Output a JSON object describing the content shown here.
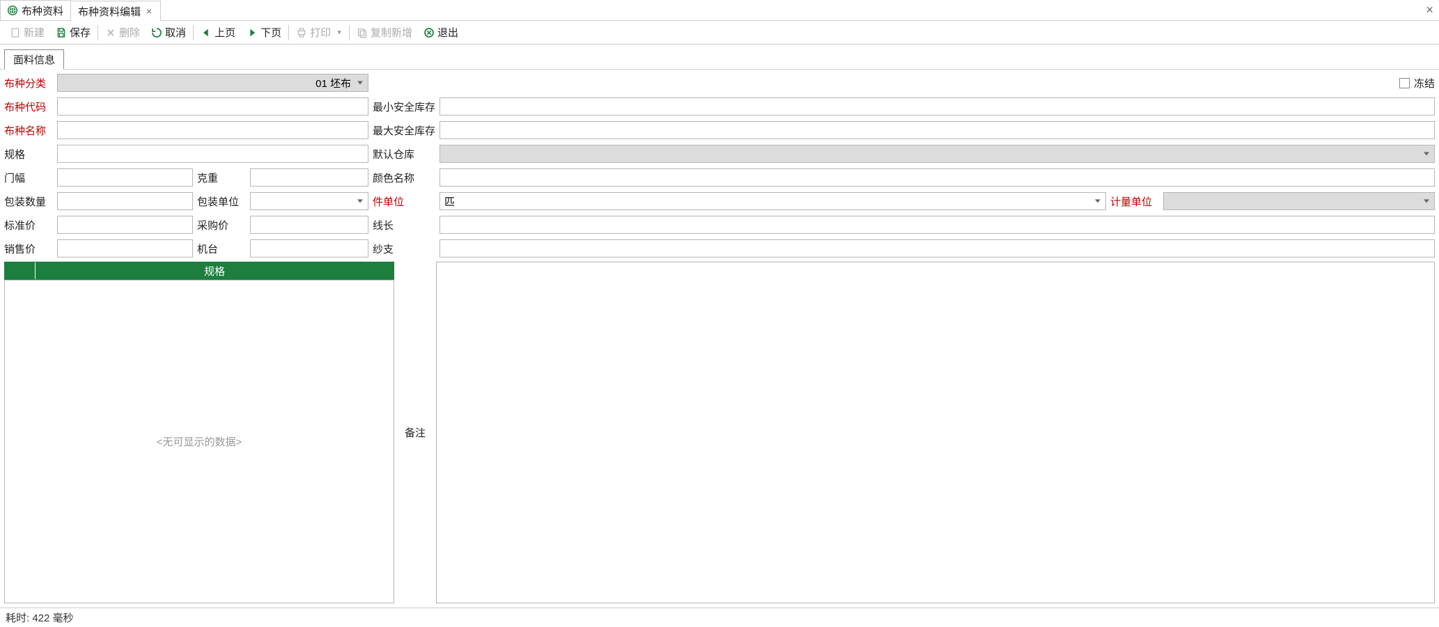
{
  "tabs": [
    {
      "label": "布种资料",
      "icon": "globe-icon",
      "closable": false
    },
    {
      "label": "布种资料编辑",
      "closable": true,
      "active": true
    }
  ],
  "toolbar": {
    "new": "新建",
    "save": "保存",
    "delete": "删除",
    "cancel": "取消",
    "prev": "上页",
    "next": "下页",
    "print": "打印",
    "copy_new": "复制新增",
    "exit": "退出"
  },
  "subtab": "面料信息",
  "form": {
    "category": {
      "label": "布种分类",
      "value": "01 坯布"
    },
    "frozen_label": "冻结",
    "code": {
      "label": "布种代码",
      "value": ""
    },
    "min_stock": {
      "label": "最小安全库存",
      "value": ""
    },
    "name": {
      "label": "布种名称",
      "value": ""
    },
    "max_stock": {
      "label": "最大安全库存",
      "value": ""
    },
    "spec": {
      "label": "规格",
      "value": ""
    },
    "default_wh": {
      "label": "默认仓库",
      "value": ""
    },
    "width": {
      "label": "门幅",
      "value": ""
    },
    "weight": {
      "label": "克重",
      "value": ""
    },
    "color": {
      "label": "颜色名称",
      "value": ""
    },
    "pack_qty": {
      "label": "包装数量",
      "value": ""
    },
    "pack_unit": {
      "label": "包装单位",
      "value": ""
    },
    "piece_unit": {
      "label": "件单位",
      "value": "匹"
    },
    "measure_unit": {
      "label": "计量单位",
      "value": ""
    },
    "std_price": {
      "label": "标准价",
      "value": ""
    },
    "purchase_price": {
      "label": "采购价",
      "value": ""
    },
    "line_len": {
      "label": "线长",
      "value": ""
    },
    "sale_price": {
      "label": "销售价",
      "value": ""
    },
    "machine": {
      "label": "机台",
      "value": ""
    },
    "yarn": {
      "label": "纱支",
      "value": ""
    }
  },
  "spec_grid": {
    "header": "规格",
    "empty_text": "<无可显示的数据>"
  },
  "remarks_label": "备注",
  "remarks_value": "",
  "status": "耗时: 422 毫秒"
}
